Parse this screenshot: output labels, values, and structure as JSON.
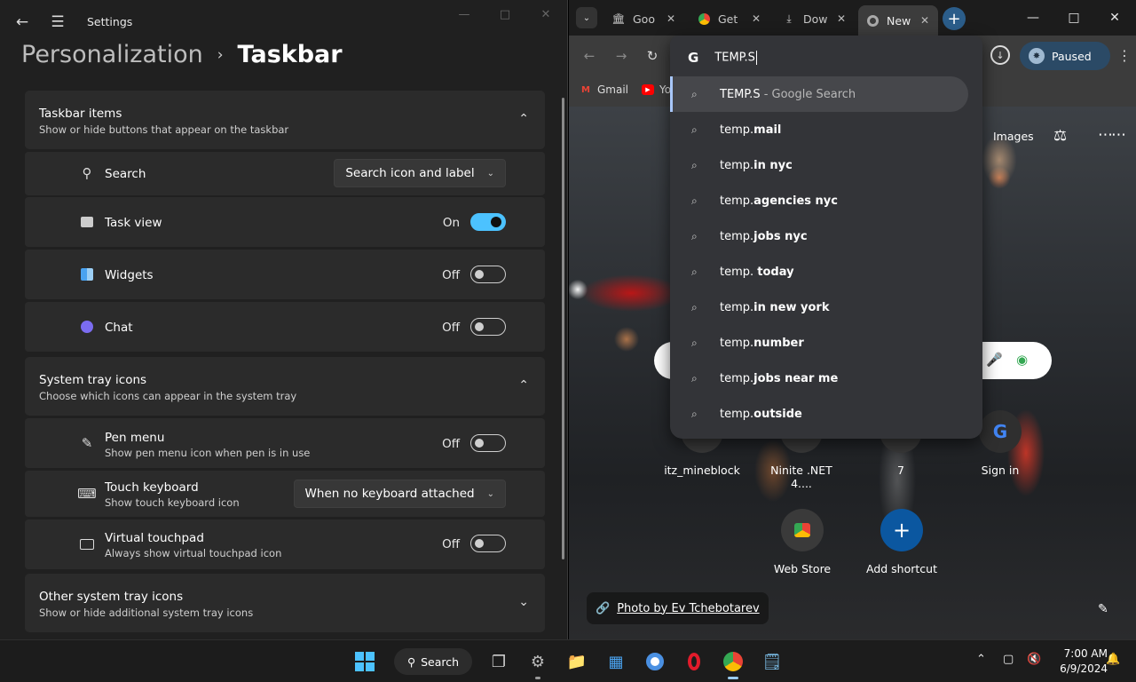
{
  "settings": {
    "app_title": "Settings",
    "breadcrumb": {
      "parent": "Personalization",
      "current": "Taskbar"
    },
    "taskbar_items": {
      "title": "Taskbar items",
      "subtitle": "Show or hide buttons that appear on the taskbar",
      "rows": [
        {
          "label": "Search",
          "control": "dropdown",
          "value": "Search icon and label"
        },
        {
          "label": "Task view",
          "control": "toggle",
          "state": "On"
        },
        {
          "label": "Widgets",
          "control": "toggle",
          "state": "Off"
        },
        {
          "label": "Chat",
          "control": "toggle",
          "state": "Off"
        }
      ]
    },
    "system_tray": {
      "title": "System tray icons",
      "subtitle": "Choose which icons can appear in the system tray",
      "rows": [
        {
          "label": "Pen menu",
          "subtitle": "Show pen menu icon when pen is in use",
          "control": "toggle",
          "state": "Off"
        },
        {
          "label": "Touch keyboard",
          "subtitle": "Show touch keyboard icon",
          "control": "dropdown",
          "value": "When no keyboard attached"
        },
        {
          "label": "Virtual touchpad",
          "subtitle": "Always show virtual touchpad icon",
          "control": "toggle",
          "state": "Off"
        }
      ]
    },
    "other_tray": {
      "title": "Other system tray icons",
      "subtitle": "Show or hide additional system tray icons"
    }
  },
  "chrome": {
    "tabs": [
      {
        "title": "Goo",
        "icon": "bank-icon"
      },
      {
        "title": "Get",
        "icon": "chrome-icon"
      },
      {
        "title": "Dow",
        "icon": "download-icon"
      },
      {
        "title": "New",
        "icon": "chrome-gray-icon",
        "active": true
      }
    ],
    "profile_status": "Paused",
    "bookmarks": [
      {
        "label": "Gmail",
        "icon": "gmail-icon"
      },
      {
        "label": "Yo",
        "icon": "youtube-icon"
      }
    ],
    "omnibox": {
      "input": "TEMP.S",
      "suggestions": [
        {
          "prefix": "TEMP.S",
          "rest": "",
          "suffix": " - Google Search",
          "selected": true
        },
        {
          "prefix": "temp.",
          "rest": "mail"
        },
        {
          "prefix": "temp.",
          "rest": "in nyc"
        },
        {
          "prefix": "temp.",
          "rest": "agencies nyc"
        },
        {
          "prefix": "temp.",
          "rest": "jobs nyc"
        },
        {
          "prefix": "temp. ",
          "rest": "today"
        },
        {
          "prefix": "temp.",
          "rest": "in new york"
        },
        {
          "prefix": "temp.",
          "rest": "number"
        },
        {
          "prefix": "temp.",
          "rest": "jobs near me"
        },
        {
          "prefix": "temp.",
          "rest": "outside"
        }
      ]
    },
    "ntp": {
      "images_link": "Images",
      "shortcuts": [
        {
          "label": "itz_mineblock"
        },
        {
          "label": "Ninite .NET 4...."
        },
        {
          "label": "7"
        },
        {
          "label": "Sign in",
          "glyph": "G"
        },
        {
          "label": "Web Store"
        },
        {
          "label": "Add shortcut",
          "glyph": "+"
        }
      ],
      "photo_credit": "Photo by Ev Tchebotarev"
    }
  },
  "taskbar": {
    "search_label": "Search",
    "time": "7:00 AM",
    "date": "6/9/2024"
  },
  "colors": {
    "accent": "#4cc2ff",
    "settings_bg": "#202020",
    "card_bg": "#2b2b2b",
    "chrome_toolbar": "#3c3c3c",
    "omnibox_bg": "#333438",
    "paused_chip": "#2b4a66"
  }
}
